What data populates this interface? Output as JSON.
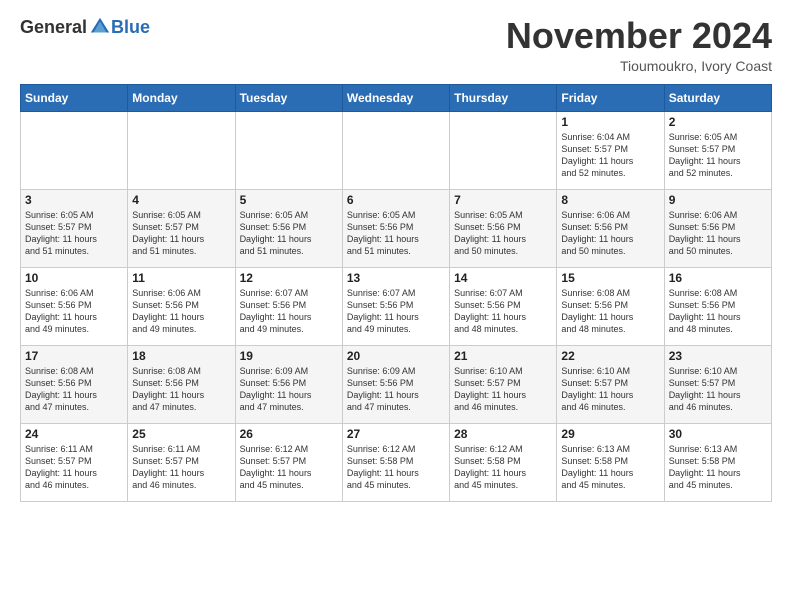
{
  "header": {
    "logo_general": "General",
    "logo_blue": "Blue",
    "month_title": "November 2024",
    "location": "Tioumoukro, Ivory Coast"
  },
  "calendar": {
    "days_of_week": [
      "Sunday",
      "Monday",
      "Tuesday",
      "Wednesday",
      "Thursday",
      "Friday",
      "Saturday"
    ],
    "weeks": [
      [
        {
          "day": "",
          "info": ""
        },
        {
          "day": "",
          "info": ""
        },
        {
          "day": "",
          "info": ""
        },
        {
          "day": "",
          "info": ""
        },
        {
          "day": "",
          "info": ""
        },
        {
          "day": "1",
          "info": "Sunrise: 6:04 AM\nSunset: 5:57 PM\nDaylight: 11 hours\nand 52 minutes."
        },
        {
          "day": "2",
          "info": "Sunrise: 6:05 AM\nSunset: 5:57 PM\nDaylight: 11 hours\nand 52 minutes."
        }
      ],
      [
        {
          "day": "3",
          "info": "Sunrise: 6:05 AM\nSunset: 5:57 PM\nDaylight: 11 hours\nand 51 minutes."
        },
        {
          "day": "4",
          "info": "Sunrise: 6:05 AM\nSunset: 5:57 PM\nDaylight: 11 hours\nand 51 minutes."
        },
        {
          "day": "5",
          "info": "Sunrise: 6:05 AM\nSunset: 5:56 PM\nDaylight: 11 hours\nand 51 minutes."
        },
        {
          "day": "6",
          "info": "Sunrise: 6:05 AM\nSunset: 5:56 PM\nDaylight: 11 hours\nand 51 minutes."
        },
        {
          "day": "7",
          "info": "Sunrise: 6:05 AM\nSunset: 5:56 PM\nDaylight: 11 hours\nand 50 minutes."
        },
        {
          "day": "8",
          "info": "Sunrise: 6:06 AM\nSunset: 5:56 PM\nDaylight: 11 hours\nand 50 minutes."
        },
        {
          "day": "9",
          "info": "Sunrise: 6:06 AM\nSunset: 5:56 PM\nDaylight: 11 hours\nand 50 minutes."
        }
      ],
      [
        {
          "day": "10",
          "info": "Sunrise: 6:06 AM\nSunset: 5:56 PM\nDaylight: 11 hours\nand 49 minutes."
        },
        {
          "day": "11",
          "info": "Sunrise: 6:06 AM\nSunset: 5:56 PM\nDaylight: 11 hours\nand 49 minutes."
        },
        {
          "day": "12",
          "info": "Sunrise: 6:07 AM\nSunset: 5:56 PM\nDaylight: 11 hours\nand 49 minutes."
        },
        {
          "day": "13",
          "info": "Sunrise: 6:07 AM\nSunset: 5:56 PM\nDaylight: 11 hours\nand 49 minutes."
        },
        {
          "day": "14",
          "info": "Sunrise: 6:07 AM\nSunset: 5:56 PM\nDaylight: 11 hours\nand 48 minutes."
        },
        {
          "day": "15",
          "info": "Sunrise: 6:08 AM\nSunset: 5:56 PM\nDaylight: 11 hours\nand 48 minutes."
        },
        {
          "day": "16",
          "info": "Sunrise: 6:08 AM\nSunset: 5:56 PM\nDaylight: 11 hours\nand 48 minutes."
        }
      ],
      [
        {
          "day": "17",
          "info": "Sunrise: 6:08 AM\nSunset: 5:56 PM\nDaylight: 11 hours\nand 47 minutes."
        },
        {
          "day": "18",
          "info": "Sunrise: 6:08 AM\nSunset: 5:56 PM\nDaylight: 11 hours\nand 47 minutes."
        },
        {
          "day": "19",
          "info": "Sunrise: 6:09 AM\nSunset: 5:56 PM\nDaylight: 11 hours\nand 47 minutes."
        },
        {
          "day": "20",
          "info": "Sunrise: 6:09 AM\nSunset: 5:56 PM\nDaylight: 11 hours\nand 47 minutes."
        },
        {
          "day": "21",
          "info": "Sunrise: 6:10 AM\nSunset: 5:57 PM\nDaylight: 11 hours\nand 46 minutes."
        },
        {
          "day": "22",
          "info": "Sunrise: 6:10 AM\nSunset: 5:57 PM\nDaylight: 11 hours\nand 46 minutes."
        },
        {
          "day": "23",
          "info": "Sunrise: 6:10 AM\nSunset: 5:57 PM\nDaylight: 11 hours\nand 46 minutes."
        }
      ],
      [
        {
          "day": "24",
          "info": "Sunrise: 6:11 AM\nSunset: 5:57 PM\nDaylight: 11 hours\nand 46 minutes."
        },
        {
          "day": "25",
          "info": "Sunrise: 6:11 AM\nSunset: 5:57 PM\nDaylight: 11 hours\nand 46 minutes."
        },
        {
          "day": "26",
          "info": "Sunrise: 6:12 AM\nSunset: 5:57 PM\nDaylight: 11 hours\nand 45 minutes."
        },
        {
          "day": "27",
          "info": "Sunrise: 6:12 AM\nSunset: 5:58 PM\nDaylight: 11 hours\nand 45 minutes."
        },
        {
          "day": "28",
          "info": "Sunrise: 6:12 AM\nSunset: 5:58 PM\nDaylight: 11 hours\nand 45 minutes."
        },
        {
          "day": "29",
          "info": "Sunrise: 6:13 AM\nSunset: 5:58 PM\nDaylight: 11 hours\nand 45 minutes."
        },
        {
          "day": "30",
          "info": "Sunrise: 6:13 AM\nSunset: 5:58 PM\nDaylight: 11 hours\nand 45 minutes."
        }
      ]
    ]
  }
}
